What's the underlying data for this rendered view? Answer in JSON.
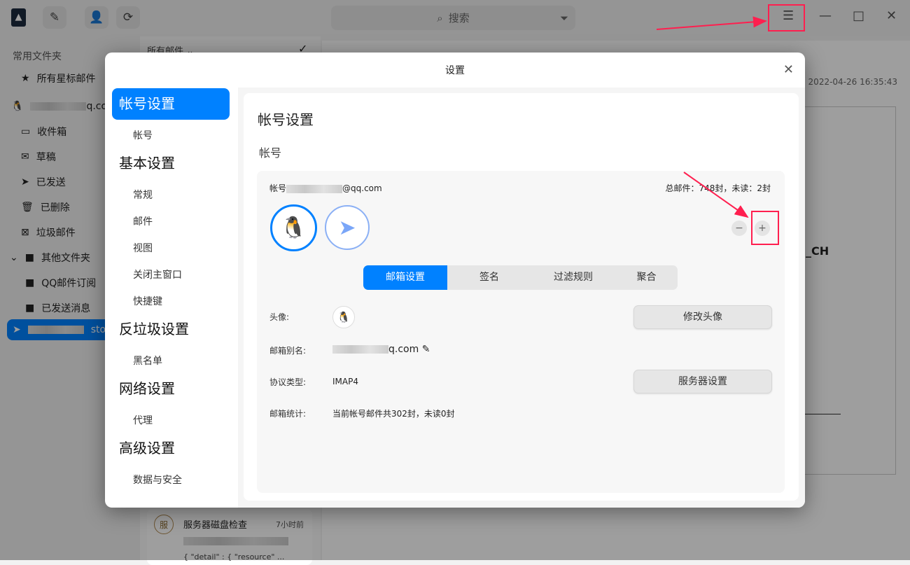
{
  "app": {
    "search_placeholder": "搜索"
  },
  "sidebar": {
    "section": "常用文件夹",
    "starred": "所有星标邮件",
    "account1": "q.com",
    "items": [
      {
        "label": "收件箱",
        "icon": "inbox"
      },
      {
        "label": "草稿",
        "icon": "drafts"
      },
      {
        "label": "已发送",
        "icon": "send"
      },
      {
        "label": "已删除",
        "icon": "trash"
      },
      {
        "label": "垃圾邮件",
        "icon": "spam"
      }
    ],
    "other": "其他文件夹",
    "sub": [
      "QQ邮件订阅",
      "已发送消息"
    ],
    "account2": "store"
  },
  "mail_list": {
    "filter": "所有邮件",
    "item": {
      "avatar": "服",
      "subject": "服务器磁盘检查",
      "time": "7小时前",
      "preview": "{ \"detail\" : { \"resource\" ..."
    }
  },
  "content": {
    "date": "2022-04-26 16:35:43",
    "text": "_CH"
  },
  "dialog": {
    "title": "设置",
    "nav": [
      {
        "h": "帐号设置",
        "subs": [
          "帐号"
        ]
      },
      {
        "h": "基本设置",
        "subs": [
          "常规",
          "邮件",
          "视图",
          "关闭主窗口",
          "快捷键"
        ]
      },
      {
        "h": "反垃圾设置",
        "subs": [
          "黑名单"
        ]
      },
      {
        "h": "网络设置",
        "subs": [
          "代理"
        ]
      },
      {
        "h": "高级设置",
        "subs": [
          "数据与安全"
        ]
      }
    ],
    "heading": "帐号设置",
    "subheading": "帐号",
    "account": {
      "label": "帐号",
      "email_suffix": "@qq.com",
      "stats": "总邮件：748封，未读：2封"
    },
    "tabs": [
      "邮箱设置",
      "签名",
      "过滤规则",
      "聚合"
    ],
    "fields": {
      "avatar_label": "头像:",
      "change_avatar": "修改头像",
      "alias_label": "邮箱别名:",
      "alias_value": "q.com",
      "protocol_label": "协议类型:",
      "protocol_value": "IMAP4",
      "server_settings": "服务器设置",
      "stats_label": "邮箱统计:",
      "stats_value": "当前帐号邮件共302封，未读0封"
    }
  },
  "colors": {
    "accent": "#0081ff",
    "annotation": "#ff1f4f"
  }
}
